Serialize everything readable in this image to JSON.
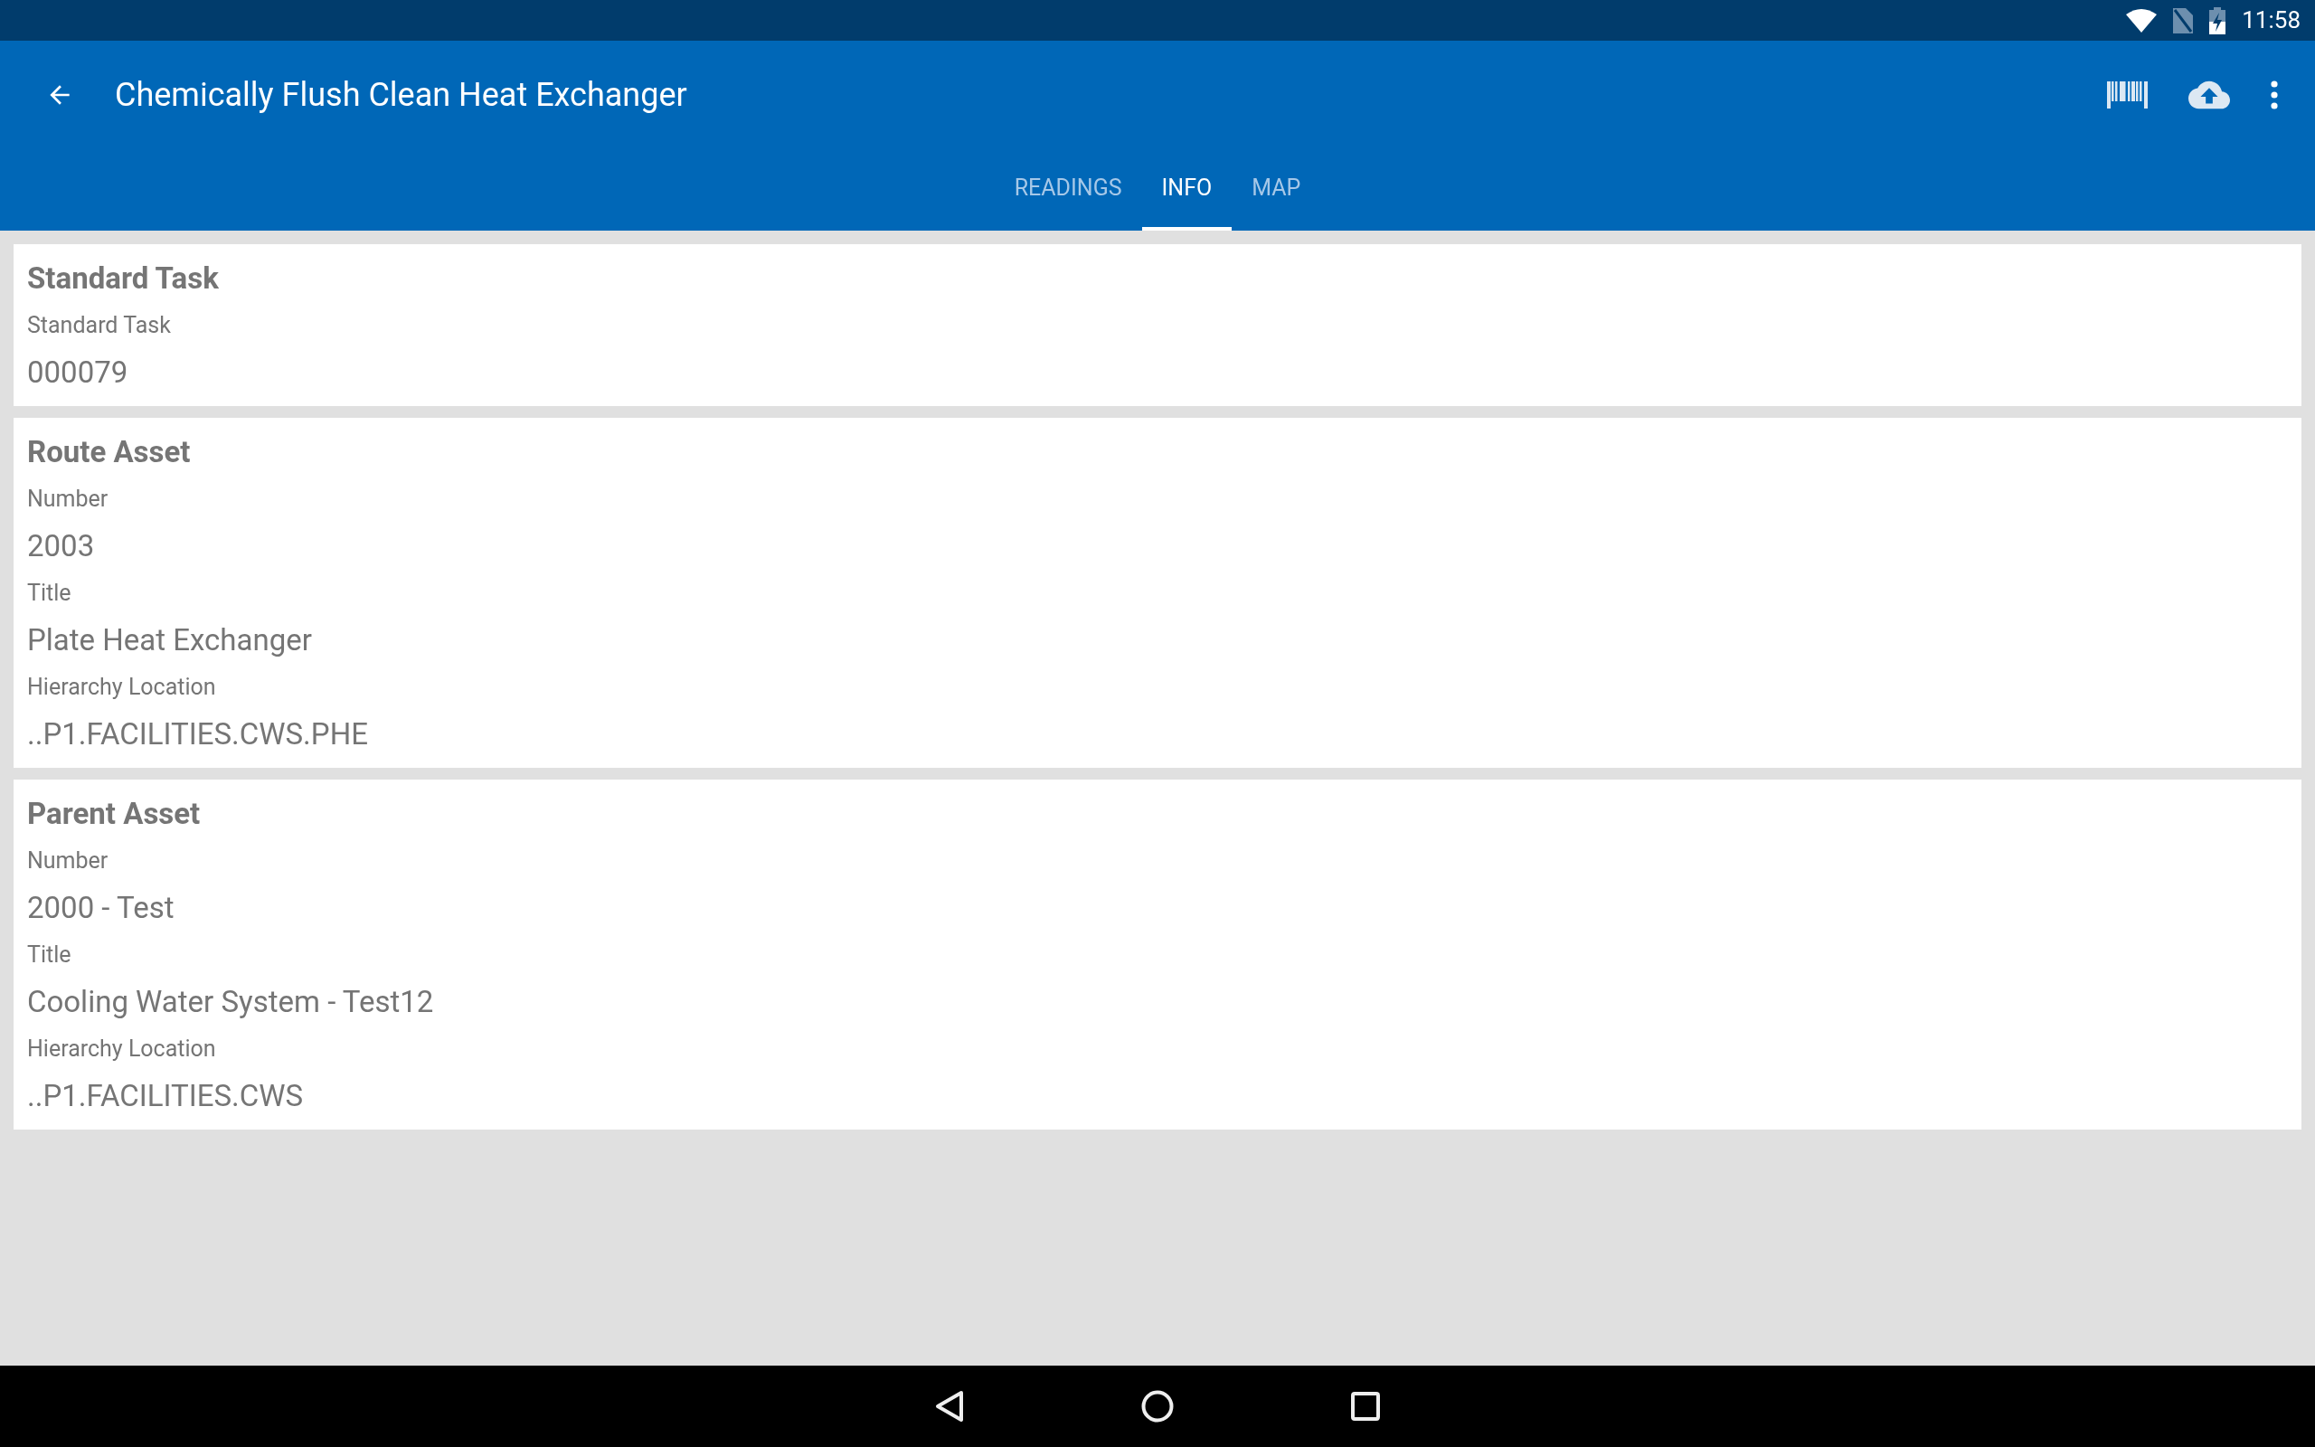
{
  "status_bar": {
    "time": "11:58"
  },
  "toolbar": {
    "title": "Chemically Flush Clean Heat Exchanger"
  },
  "tabs": [
    {
      "label": "READINGS",
      "selected": false
    },
    {
      "label": "INFO",
      "selected": true
    },
    {
      "label": "MAP",
      "selected": false
    }
  ],
  "cards": [
    {
      "title": "Standard Task",
      "fields": [
        {
          "label": "Standard Task",
          "value": "000079"
        }
      ]
    },
    {
      "title": "Route Asset",
      "fields": [
        {
          "label": "Number",
          "value": "2003"
        },
        {
          "label": "Title",
          "value": "Plate Heat Exchanger"
        },
        {
          "label": "Hierarchy Location",
          "value": "..P1.FACILITIES.CWS.PHE"
        }
      ]
    },
    {
      "title": "Parent Asset",
      "fields": [
        {
          "label": "Number",
          "value": "2000 - Test"
        },
        {
          "label": "Title",
          "value": "Cooling Water System - Test12"
        },
        {
          "label": "Hierarchy Location",
          "value": "..P1.FACILITIES.CWS"
        }
      ]
    }
  ]
}
